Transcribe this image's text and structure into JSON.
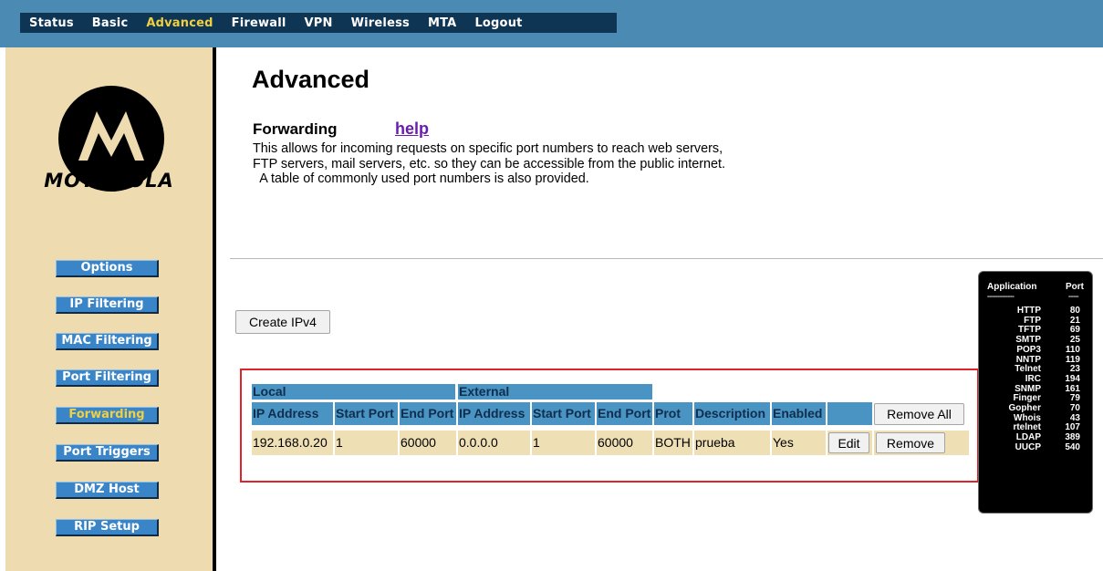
{
  "top_nav": [
    "Status",
    "Basic",
    "Advanced",
    "Firewall",
    "VPN",
    "Wireless",
    "MTA",
    "Logout"
  ],
  "top_nav_active": "Advanced",
  "brand": "MOTOROLA",
  "sidebar": [
    {
      "label": "Options",
      "active": false
    },
    {
      "label": "IP Filtering",
      "active": false
    },
    {
      "label": "MAC Filtering",
      "active": false
    },
    {
      "label": "Port Filtering",
      "active": false
    },
    {
      "label": "Forwarding",
      "active": true
    },
    {
      "label": "Port Triggers",
      "active": false
    },
    {
      "label": "DMZ Host",
      "active": false
    },
    {
      "label": "RIP Setup",
      "active": false
    }
  ],
  "page_title": "Advanced",
  "section_title": "Forwarding",
  "help_link": "help",
  "description": [
    "This allows for incoming requests on specific port numbers to reach  web servers,",
    "FTP servers, mail servers, etc. so they can be accessible from the public internet.",
    "  A table of commonly used port numbers is also provided."
  ],
  "create_button": "Create IPv4",
  "forward_table": {
    "group_headers": [
      "Local",
      "External"
    ],
    "columns": [
      "IP Address",
      "Start Port",
      "End Port",
      "IP Address",
      "Start Port",
      "End Port",
      "Prot",
      "Description",
      "Enabled"
    ],
    "remove_all_label": "Remove All",
    "rows": [
      {
        "cells": [
          "192.168.0.20",
          "1",
          "60000",
          "0.0.0.0",
          "1",
          "60000",
          "BOTH",
          "prueba",
          "Yes"
        ],
        "edit_label": "Edit",
        "remove_label": "Remove"
      }
    ]
  },
  "port_reference": {
    "headers": [
      "Application",
      "Port"
    ],
    "separators": [
      "----------------",
      "------"
    ],
    "rows": [
      [
        "HTTP",
        "80"
      ],
      [
        "FTP",
        "21"
      ],
      [
        "TFTP",
        "69"
      ],
      [
        "SMTP",
        "25"
      ],
      [
        "POP3",
        "110"
      ],
      [
        "NNTP",
        "119"
      ],
      [
        "Telnet",
        "23"
      ],
      [
        "IRC",
        "194"
      ],
      [
        "SNMP",
        "161"
      ],
      [
        "Finger",
        "79"
      ],
      [
        "Gopher",
        "70"
      ],
      [
        "Whois",
        "43"
      ],
      [
        "rtelnet",
        "107"
      ],
      [
        "LDAP",
        "389"
      ],
      [
        "UUCP",
        "540"
      ]
    ]
  },
  "colors": {
    "top_bar": "#4a8ab3",
    "nav_background": "#0f3555",
    "sidebar_background": "#eedcb0",
    "sidebar_button": "#3a85c8",
    "active_text": "#f0d040",
    "table_header": "#4a94c4",
    "table_row": "#efdfb5",
    "highlight_border": "#e0222a",
    "help_link": "#6a1bb0"
  }
}
